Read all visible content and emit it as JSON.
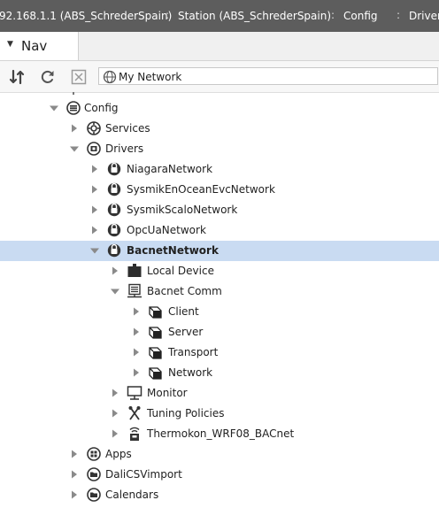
{
  "breadcrumb": {
    "items": [
      "92.168.1.1 (ABS_SchrederSpain)",
      "Station (ABS_SchrederSpain)",
      "Config",
      "Drivers"
    ],
    "separator": ":"
  },
  "nav": {
    "tab_label": "Nav"
  },
  "toolbar": {
    "selector_label": "My Network"
  },
  "tree": {
    "rows": [
      {
        "label": "Config",
        "icon": "config-icon",
        "expanded": true
      },
      {
        "label": "Services",
        "icon": "services-icon",
        "expanded": false
      },
      {
        "label": "Drivers",
        "icon": "drivers-icon",
        "expanded": true
      },
      {
        "label": "NiagaraNetwork",
        "icon": "network-icon",
        "expanded": false
      },
      {
        "label": "SysmikEnOceanEvcNetwork",
        "icon": "network-icon",
        "expanded": false
      },
      {
        "label": "SysmikScaloNetwork",
        "icon": "network-icon",
        "expanded": false
      },
      {
        "label": "OpcUaNetwork",
        "icon": "network-icon",
        "expanded": false
      },
      {
        "label": "BacnetNetwork",
        "icon": "network-icon",
        "expanded": true,
        "selected": true
      },
      {
        "label": "Local Device",
        "icon": "local-device-icon",
        "expanded": false
      },
      {
        "label": "Bacnet Comm",
        "icon": "comm-icon",
        "expanded": true
      },
      {
        "label": "Client",
        "icon": "cube-icon",
        "expanded": false
      },
      {
        "label": "Server",
        "icon": "cube-icon",
        "expanded": false
      },
      {
        "label": "Transport",
        "icon": "cube-icon",
        "expanded": false
      },
      {
        "label": "Network",
        "icon": "cube-icon",
        "expanded": false
      },
      {
        "label": "Monitor",
        "icon": "monitor-icon",
        "expanded": false
      },
      {
        "label": "Tuning Policies",
        "icon": "tuning-icon",
        "expanded": false
      },
      {
        "label": "Thermokon_WRF08_BACnet",
        "icon": "device-icon",
        "expanded": false
      },
      {
        "label": "Apps",
        "icon": "apps-icon",
        "expanded": false
      },
      {
        "label": "DaliCSVimport",
        "icon": "folder-icon",
        "expanded": false
      },
      {
        "label": "Calendars",
        "icon": "folder-icon",
        "expanded": false
      }
    ]
  },
  "colors": {
    "topbar_bg": "#5d5d5d",
    "selection_bg": "#c9dbf2",
    "arrow": "#8a8a8a"
  }
}
